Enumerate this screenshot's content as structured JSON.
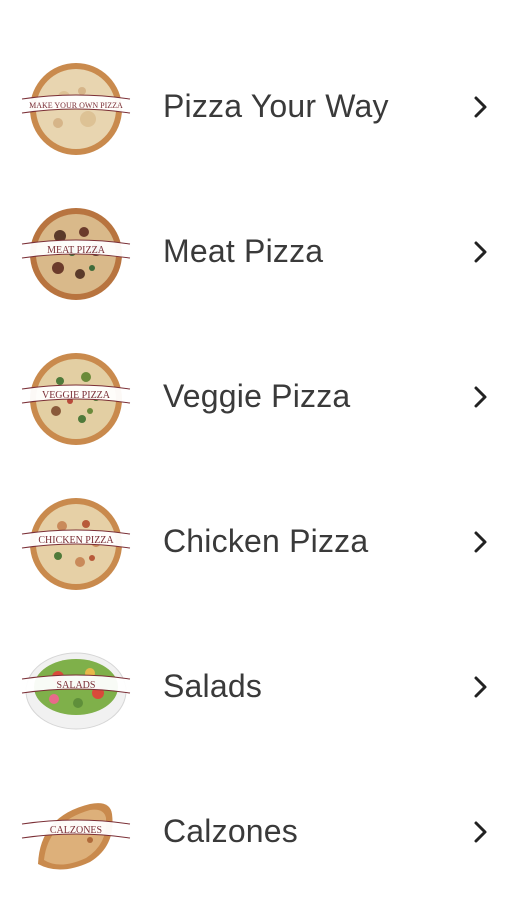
{
  "menu": {
    "items": [
      {
        "label": "Pizza Your Way",
        "badge": "MAKE YOUR OWN PIZZA",
        "image": "pizza-plain"
      },
      {
        "label": "Meat Pizza",
        "badge": "MEAT PIZZA",
        "image": "pizza-meat"
      },
      {
        "label": "Veggie Pizza",
        "badge": "VEGGIE PIZZA",
        "image": "pizza-veggie"
      },
      {
        "label": "Chicken Pizza",
        "badge": "CHICKEN PIZZA",
        "image": "pizza-chicken"
      },
      {
        "label": "Salads",
        "badge": "SALADS",
        "image": "salad-bowl"
      },
      {
        "label": "Calzones",
        "badge": "CALZONES",
        "image": "calzone"
      }
    ],
    "chevron_icon": "chevron-right-icon"
  },
  "colors": {
    "text": "#3a3a3a",
    "banner_text": "#7a2e35",
    "background": "#ffffff"
  }
}
